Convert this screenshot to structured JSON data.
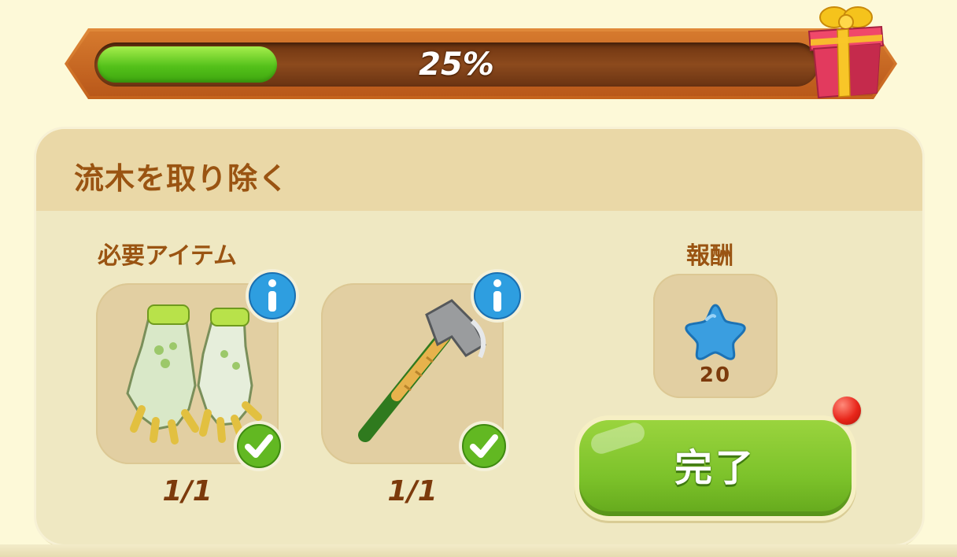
{
  "progress": {
    "value": 0.25,
    "label": "25%"
  },
  "task": {
    "title": "流木を取り除く"
  },
  "required_items": {
    "label": "必要アイテム",
    "items": [
      {
        "icon": "gloves-icon",
        "count": "1/1"
      },
      {
        "icon": "axe-icon",
        "count": "1/1"
      }
    ]
  },
  "reward": {
    "label": "報酬",
    "icon": "blue-star-icon",
    "amount": "20"
  },
  "complete_button": {
    "label": "完了"
  },
  "colors": {
    "background": "#fdf9d8",
    "panel": "#efe8c2",
    "header_text": "#9a5412",
    "progress_fill": "#54c11a",
    "button_green": "#7cc22a",
    "notification_red": "#e8261a"
  }
}
